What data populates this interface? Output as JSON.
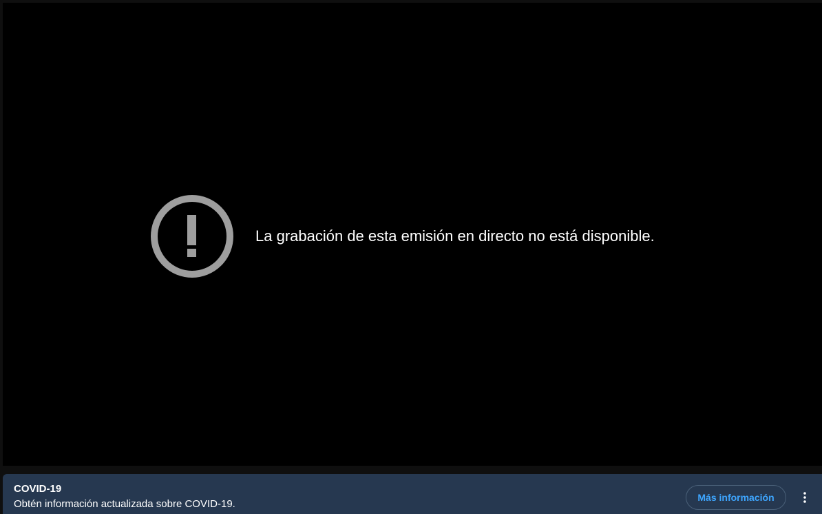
{
  "player": {
    "error_icon": "exclamation-circle-icon",
    "error_message": "La grabación de esta emisión en directo no está disponible."
  },
  "info_panel": {
    "title": "COVID-19",
    "description": "Obtén información actualizada sobre COVID-19.",
    "button_label": "Más información",
    "menu_icon": "more-vertical-icon"
  },
  "colors": {
    "player_background": "#000000",
    "panel_background": "#263850",
    "button_text": "#3ea6ff",
    "error_icon": "#9e9e9e"
  }
}
